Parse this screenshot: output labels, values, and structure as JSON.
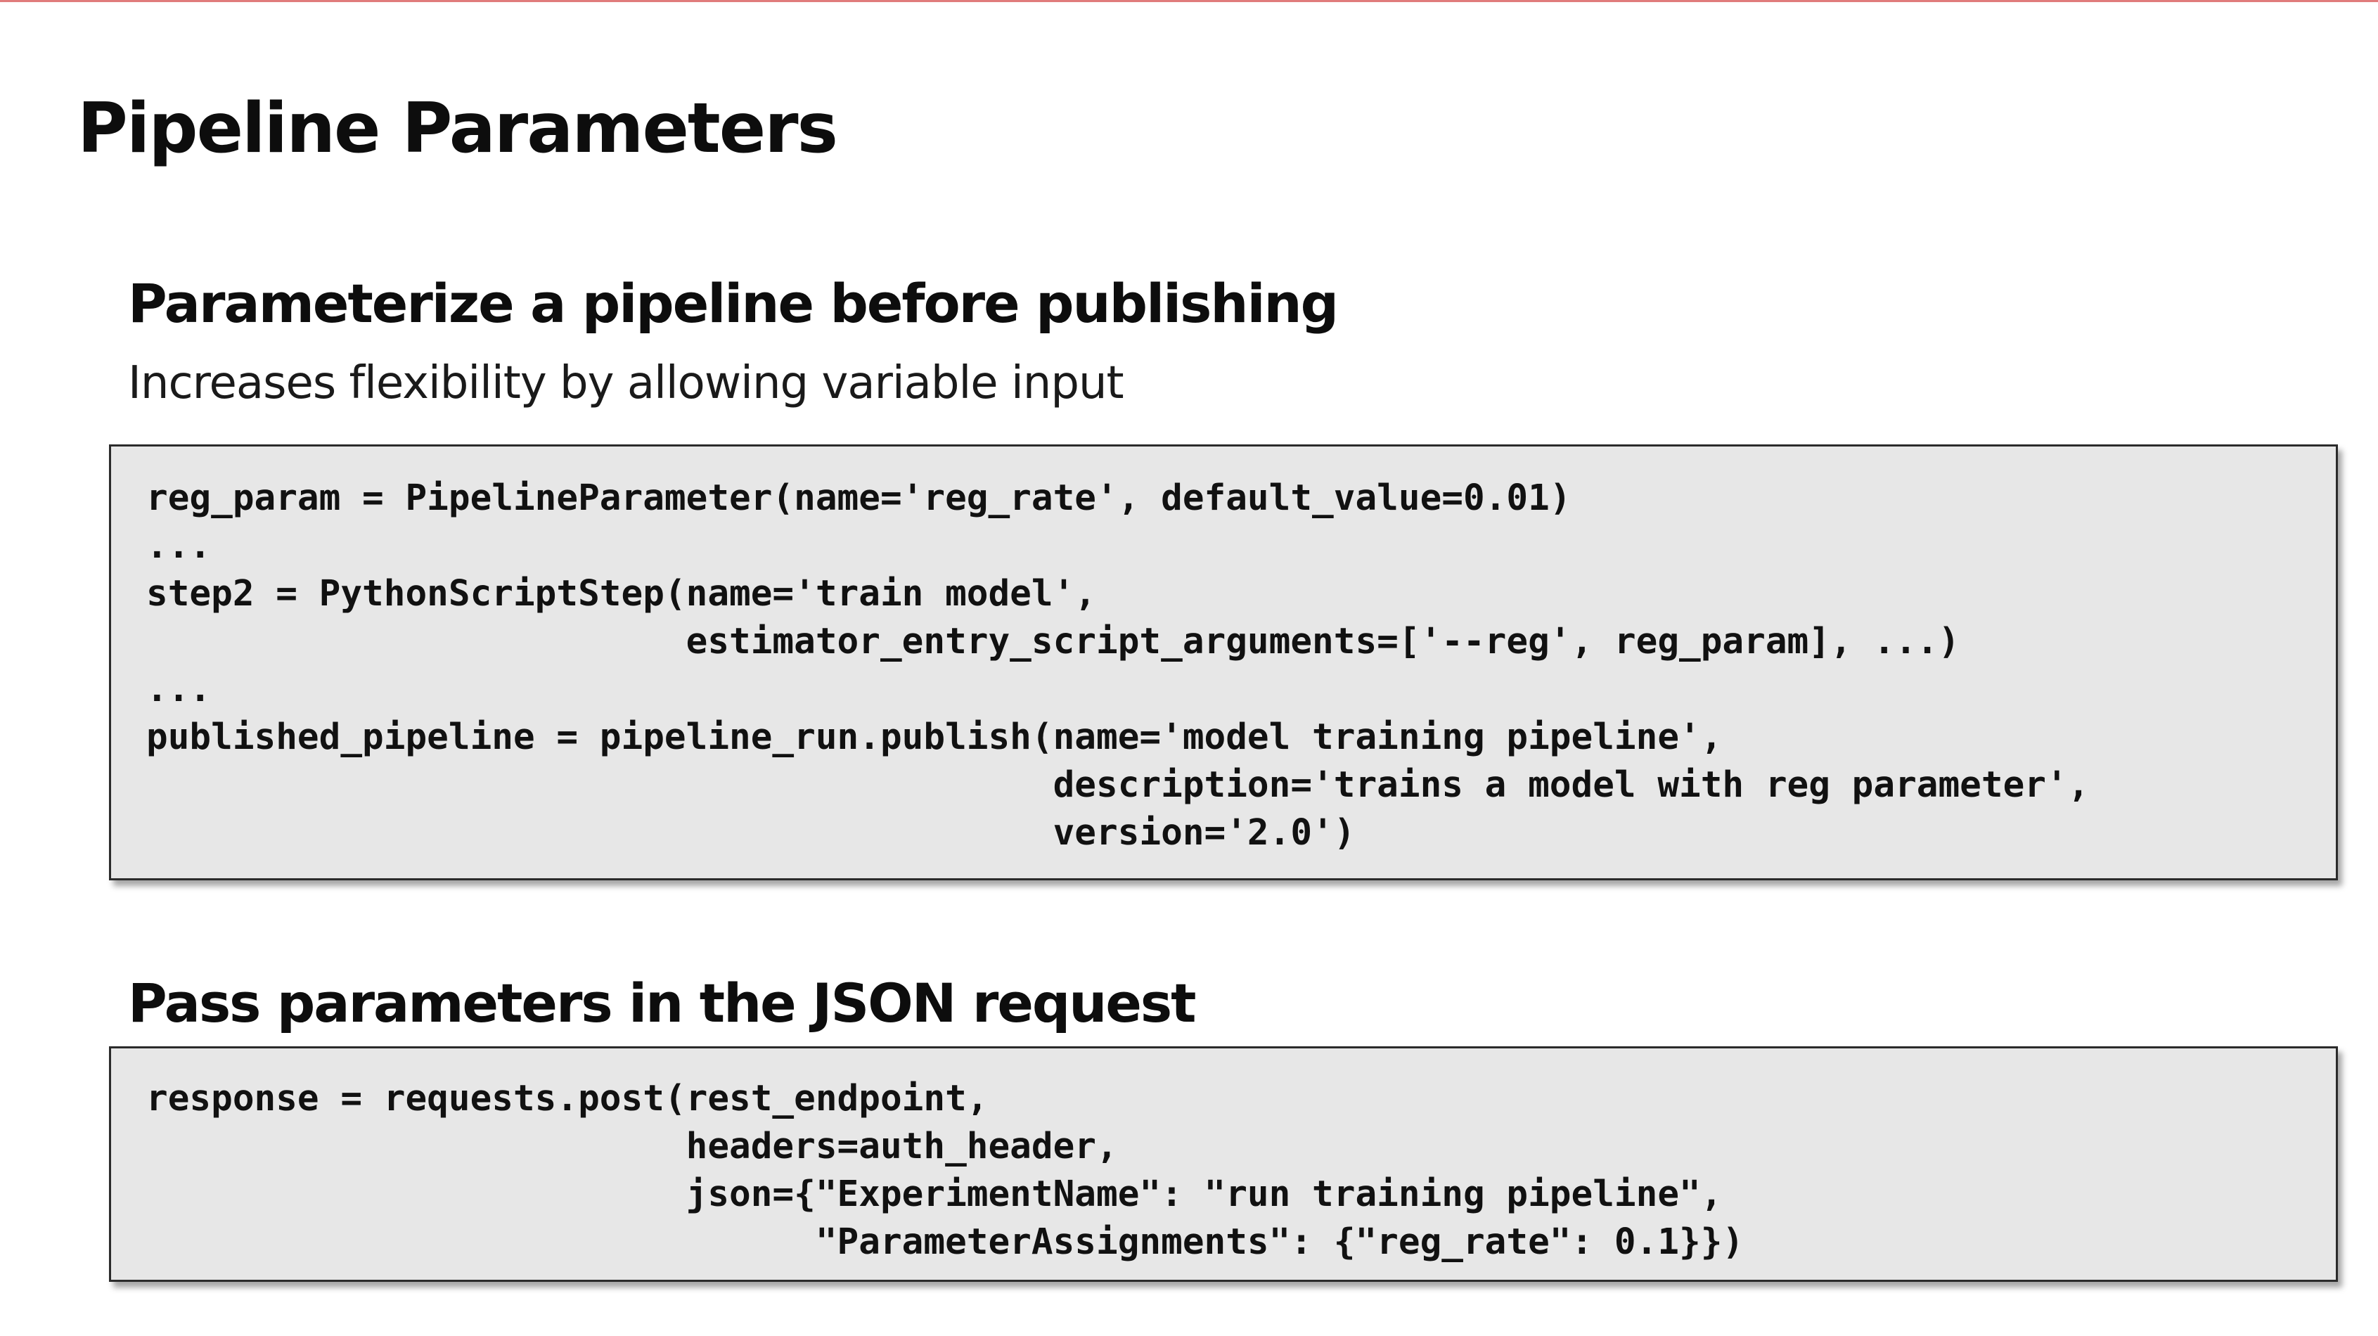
{
  "slide": {
    "title": "Pipeline Parameters"
  },
  "sections": [
    {
      "heading": "Parameterize a pipeline before publishing",
      "subtitle": "Increases flexibility by allowing variable input",
      "code": "reg_param = PipelineParameter(name='reg_rate', default_value=0.01)\n...\nstep2 = PythonScriptStep(name='train model',\n                         estimator_entry_script_arguments=['--reg', reg_param], ...)\n...\npublished_pipeline = pipeline_run.publish(name='model training pipeline',\n                                          description='trains a model with reg parameter',\n                                          version='2.0')"
    },
    {
      "heading": "Pass parameters in the JSON request",
      "code": "response = requests.post(rest_endpoint,\n                         headers=auth_header,\n                         json={\"ExperimentName\": \"run training pipeline\",\n                               \"ParameterAssignments\": {\"reg_rate\": 0.1}})"
    }
  ],
  "colors": {
    "accent_rule": "#e07b7b",
    "code_background": "#e7e7e7",
    "code_border": "#2b2b2b"
  }
}
